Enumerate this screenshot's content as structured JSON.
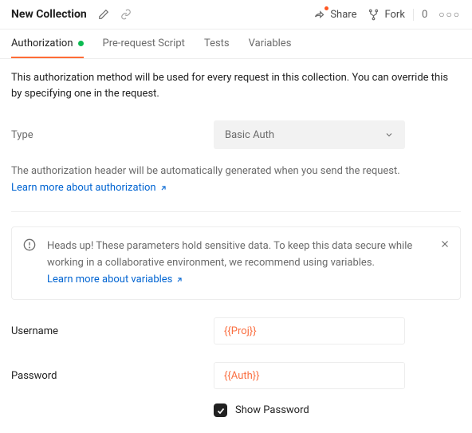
{
  "header": {
    "title": "New Collection",
    "share_label": "Share",
    "fork_label": "Fork",
    "fork_count": "0"
  },
  "tabs": [
    {
      "label": "Authorization",
      "active": true,
      "indicator": true
    },
    {
      "label": "Pre-request Script",
      "active": false
    },
    {
      "label": "Tests",
      "active": false
    },
    {
      "label": "Variables",
      "active": false
    }
  ],
  "main": {
    "description": "This authorization method will be used for every request in this collection. You can override this by specifying one in the request.",
    "type_label": "Type",
    "type_value": "Basic Auth",
    "auto_generated_note": "The authorization header will be automatically generated when you send the request.",
    "learn_more_auth": "Learn more about authorization",
    "alert_text": "Heads up! These parameters hold sensitive data. To keep this data secure while working in a collaborative environment, we recommend using variables.",
    "learn_more_vars": "Learn more about variables",
    "username_label": "Username",
    "username_value": "{{Proj}}",
    "password_label": "Password",
    "password_value": "{{Auth}}",
    "show_password_label": "Show Password",
    "show_password_checked": true
  }
}
